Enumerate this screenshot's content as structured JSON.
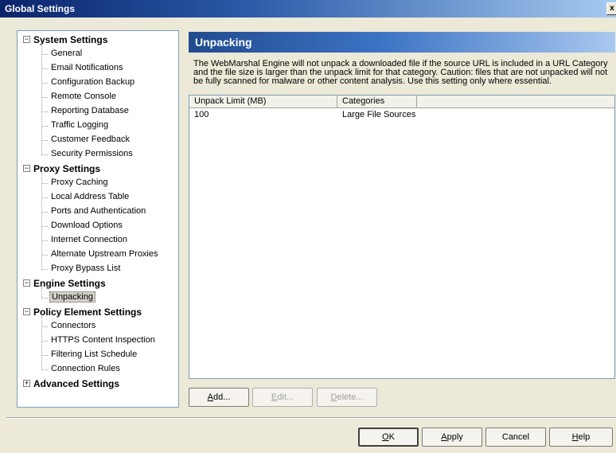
{
  "window": {
    "title": "Global Settings",
    "close_label": "x"
  },
  "tree": {
    "categories": [
      {
        "label": "System Settings",
        "expander": "−",
        "items": [
          "General",
          "Email Notifications",
          "Configuration Backup",
          "Remote Console",
          "Reporting Database",
          "Traffic Logging",
          "Customer Feedback",
          "Security Permissions"
        ]
      },
      {
        "label": "Proxy Settings",
        "expander": "−",
        "items": [
          "Proxy Caching",
          "Local Address Table",
          "Ports and Authentication",
          "Download Options",
          "Internet Connection",
          "Alternate Upstream Proxies",
          "Proxy Bypass List"
        ]
      },
      {
        "label": "Engine Settings",
        "expander": "−",
        "items": [
          "Unpacking"
        ]
      },
      {
        "label": "Policy Element Settings",
        "expander": "−",
        "items": [
          "Connectors",
          "HTTPS Content Inspection",
          "Filtering List Schedule",
          "Connection Rules"
        ]
      },
      {
        "label": "Advanced Settings",
        "expander": "+",
        "items": []
      }
    ],
    "selected": "Unpacking"
  },
  "panel": {
    "title": "Unpacking",
    "description": "The WebMarshal Engine will not unpack a downloaded file if the source URL is included in a URL Category and the file size is larger than the unpack limit for that category. Caution: files that are not unpacked will not be fully scanned for malware or other content analysis. Use this setting only where essential."
  },
  "table": {
    "columns": [
      "Unpack Limit (MB)",
      "Categories"
    ],
    "rows": [
      [
        "100",
        "Large File Sources"
      ]
    ]
  },
  "buttons": {
    "add": "Add...",
    "edit": "Edit...",
    "delete": "Delete...",
    "ok": "OK",
    "apply": "Apply",
    "cancel": "Cancel",
    "help": "Help"
  }
}
